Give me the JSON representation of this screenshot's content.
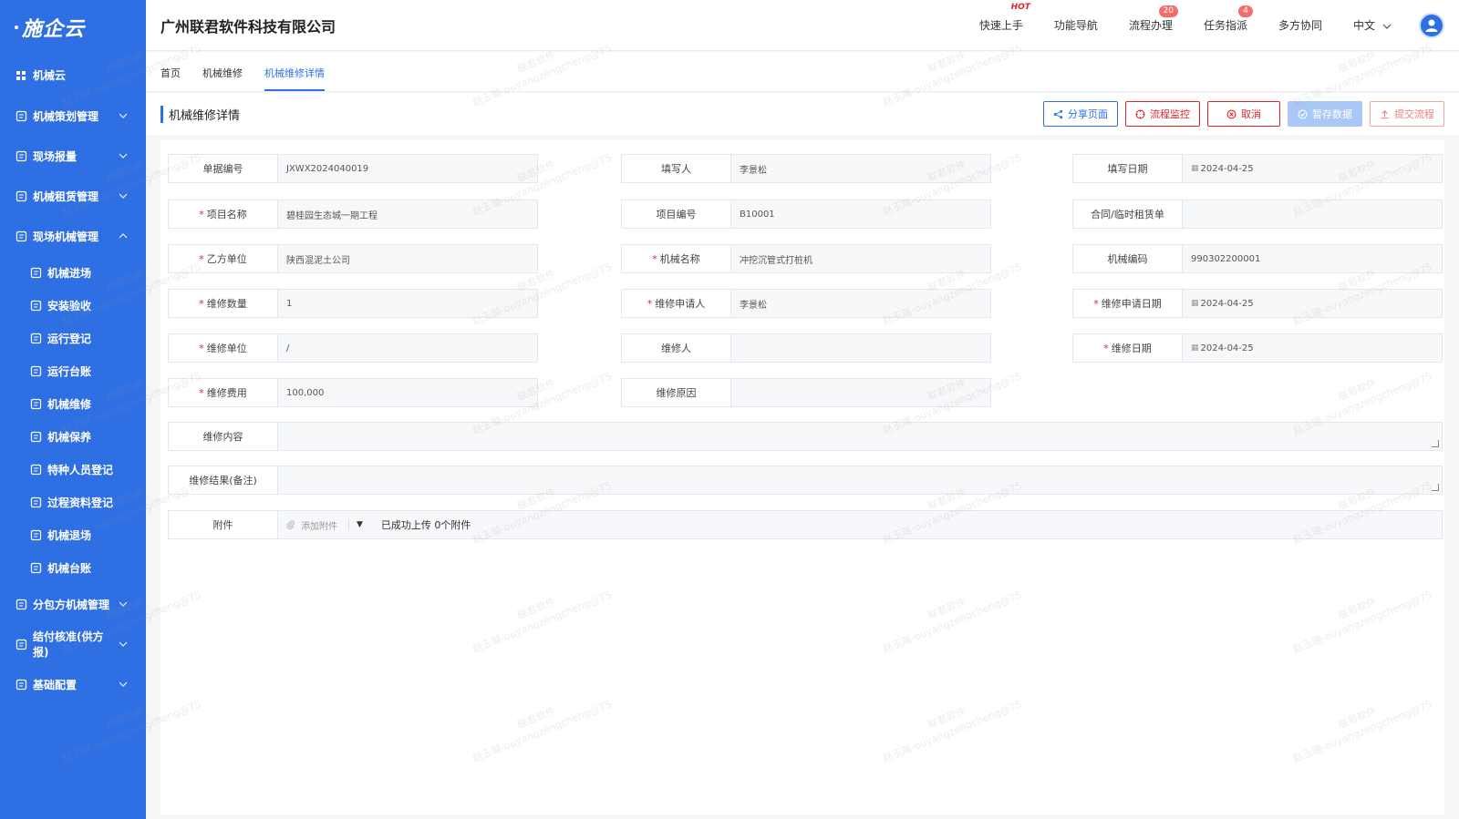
{
  "sidebar": {
    "logo": "施企云",
    "items": [
      {
        "label": "机械云",
        "type": "group",
        "icon": "grid-icon"
      },
      {
        "label": "机械策划管理",
        "type": "group",
        "icon": "plan-icon",
        "chevron": "down"
      },
      {
        "label": "现场报量",
        "type": "group",
        "icon": "report-icon",
        "chevron": "down"
      },
      {
        "label": "机械租赁管理",
        "type": "group",
        "icon": "lease-icon",
        "chevron": "down"
      },
      {
        "label": "现场机械管理",
        "type": "group",
        "icon": "site-icon",
        "chevron": "up"
      },
      {
        "label": "机械进场",
        "type": "sub",
        "icon": "enter-icon"
      },
      {
        "label": "安装验收",
        "type": "sub",
        "icon": "check-icon"
      },
      {
        "label": "运行登记",
        "type": "sub",
        "icon": "chart-icon"
      },
      {
        "label": "运行台账",
        "type": "sub",
        "icon": "ledger-icon"
      },
      {
        "label": "机械维修",
        "type": "sub",
        "icon": "repair-icon"
      },
      {
        "label": "机械保养",
        "type": "sub",
        "icon": "maintain-icon"
      },
      {
        "label": "特种人员登记",
        "type": "sub",
        "icon": "person-icon"
      },
      {
        "label": "过程资料登记",
        "type": "sub",
        "icon": "table-icon"
      },
      {
        "label": "机械退场",
        "type": "sub",
        "icon": "exit-icon"
      },
      {
        "label": "机械台账",
        "type": "sub",
        "icon": "book-icon"
      },
      {
        "label": "分包方机械管理",
        "type": "group",
        "icon": "subcontract-icon",
        "chevron": "down"
      },
      {
        "label": "结付核准(供方报)",
        "type": "group",
        "icon": "settle-icon",
        "chevron": "down"
      },
      {
        "label": "基础配置",
        "type": "group",
        "icon": "config-icon",
        "chevron": "down"
      }
    ]
  },
  "header": {
    "company": "广州联君软件科技有限公司",
    "quick_start": "快速上手",
    "hot_label": "HOT",
    "nav": "功能导航",
    "process": "流程办理",
    "process_badge": "20",
    "task": "任务指派",
    "task_badge": "4",
    "collab": "多方协同",
    "lang": "中文"
  },
  "tabs": [
    "首页",
    "机械维修",
    "机械维修详情"
  ],
  "page": {
    "title": "机械维修详情",
    "buttons": {
      "share": "分享页面",
      "monitor": "流程监控",
      "cancel": "取消",
      "save": "暂存数据",
      "submit": "提交流程"
    }
  },
  "form": {
    "doc_no_label": "单据编号",
    "doc_no": "JXWX2024040019",
    "writer_label": "填写人",
    "writer": "李景松",
    "write_date_label": "填写日期",
    "write_date": "2024-04-25",
    "project_name_label": "项目名称",
    "project_name": "碧桂园生态城一期工程",
    "project_no_label": "项目编号",
    "project_no": "B10001",
    "contract_label": "合同/临时租赁单",
    "contract": "",
    "party_b_label": "乙方单位",
    "party_b": "陕西混泥土公司",
    "machine_name_label": "机械名称",
    "machine_name": "冲挖沉管式打桩机",
    "machine_code_label": "机械编码",
    "machine_code": "990302200001",
    "qty_label": "维修数量",
    "qty": "1",
    "applicant_label": "维修申请人",
    "applicant": "李景松",
    "apply_date_label": "维修申请日期",
    "apply_date": "2024-04-25",
    "unit_label": "维修单位",
    "unit": "/",
    "repairer_label": "维修人",
    "repairer": "",
    "repair_date_label": "维修日期",
    "repair_date": "2024-04-25",
    "cost_label": "维修费用",
    "cost": "100,000",
    "reason_label": "维修原因",
    "reason": "",
    "content_label": "维修内容",
    "content": "",
    "result_label": "维修结果(备注)",
    "result": "",
    "attach_label": "附件",
    "attach_add": "添加附件",
    "attach_status": "已成功上传 0个附件"
  },
  "watermark": {
    "line1": "联君软件",
    "line2": "赵玉璐-ouyangzengcheng@75"
  },
  "colors": {
    "primary": "#2f6fe4",
    "danger": "#e0262b"
  }
}
